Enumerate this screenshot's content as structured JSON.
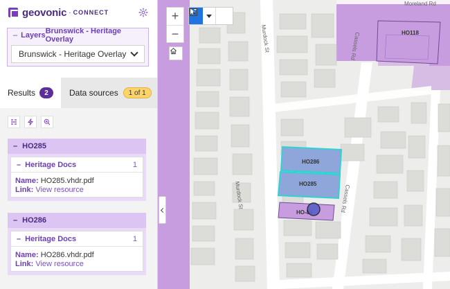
{
  "app": {
    "brand": "geovonic",
    "brand_separator": "·",
    "brand_sub": "CONNECT",
    "settings_icon": "gear-icon"
  },
  "layers_panel": {
    "label": "Layers",
    "breadcrumb": "Brunswick - Heritage Overlay",
    "selected_layer": "Brunswick - Heritage Overlay"
  },
  "tabs": {
    "results_label": "Results",
    "results_count": "2",
    "sources_label": "Data sources",
    "sources_badge": "1 of 1"
  },
  "toolbar_icons": [
    "list-filter-icon",
    "lightning-icon",
    "zoom-in-icon"
  ],
  "results": [
    {
      "id": "HO285",
      "doc_title": "Heritage Docs",
      "doc_count": "1",
      "name_label": "Name:",
      "name_value": "HO285.vhdr.pdf",
      "link_label": "Link:",
      "link_text": "View resource"
    },
    {
      "id": "HO286",
      "doc_title": "Heritage Docs",
      "doc_count": "1",
      "name_label": "Name:",
      "name_value": "HO286.vhdr.pdf",
      "link_label": "Link:",
      "link_text": "View resource"
    }
  ],
  "map": {
    "streets": {
      "murdock_top": "Murdock St",
      "murdock_bottom": "Murdock St",
      "cassels_top": "Cassels Rd",
      "cassels_bottom": "Cassels Rd",
      "moreland": "Moreland Rd"
    },
    "parcels": {
      "p118": "HO118",
      "p286": "HO286",
      "p285": "HO285",
      "p284": "HO-84"
    },
    "colors": {
      "overlay": "#c89de0",
      "selection": "#2fd3d3",
      "selected_fill": "#8ea6d9",
      "select_tool_active": "#1f74e0"
    },
    "controls": {
      "zoom_in": "+",
      "zoom_out": "−"
    }
  }
}
